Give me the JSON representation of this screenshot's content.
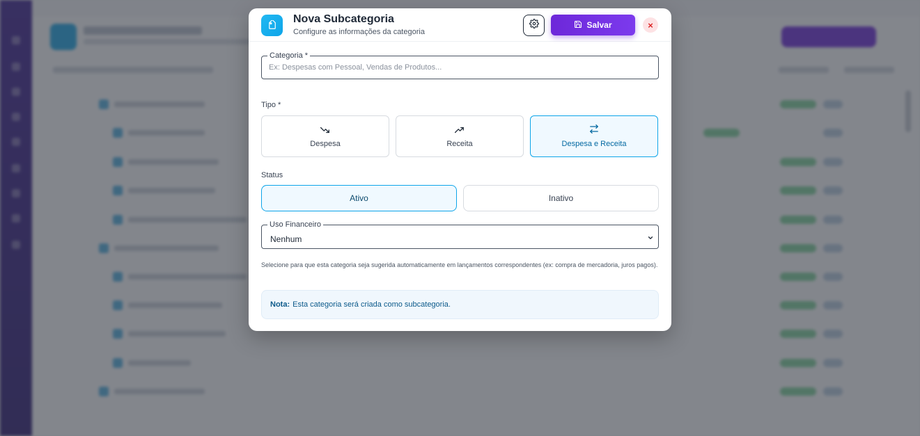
{
  "modal": {
    "title": "Nova Subcategoria",
    "subtitle": "Configure as informações da categoria",
    "save_label": "Salvar",
    "close_label": "×"
  },
  "categoria": {
    "label": "Categoria *",
    "placeholder": "Ex: Despesas com Pessoal, Vendas de Produtos...",
    "value": ""
  },
  "tipo": {
    "label": "Tipo *",
    "options": [
      {
        "label": "Despesa",
        "icon": "trending-down-icon",
        "selected": false
      },
      {
        "label": "Receita",
        "icon": "trending-up-icon",
        "selected": false
      },
      {
        "label": "Despesa e Receita",
        "icon": "arrows-exchange-icon",
        "selected": true
      }
    ]
  },
  "status": {
    "label": "Status",
    "options": [
      {
        "label": "Ativo",
        "selected": true
      },
      {
        "label": "Inativo",
        "selected": false
      }
    ]
  },
  "uso_financeiro": {
    "label": "Uso Financeiro",
    "value": "Nenhum",
    "helper": "Selecione para que esta categoria seja sugerida automaticamente em lançamentos correspondentes (ex: compra de mercadoria, juros pagos)."
  },
  "note": {
    "prefix": "Nota:",
    "text": "Esta categoria será criada como subcategoria."
  },
  "colors": {
    "accent": "#0ea5e9",
    "primary_button": "#6d28d9",
    "close_button_bg": "#fde2e4",
    "close_button_fg": "#dc2626"
  }
}
